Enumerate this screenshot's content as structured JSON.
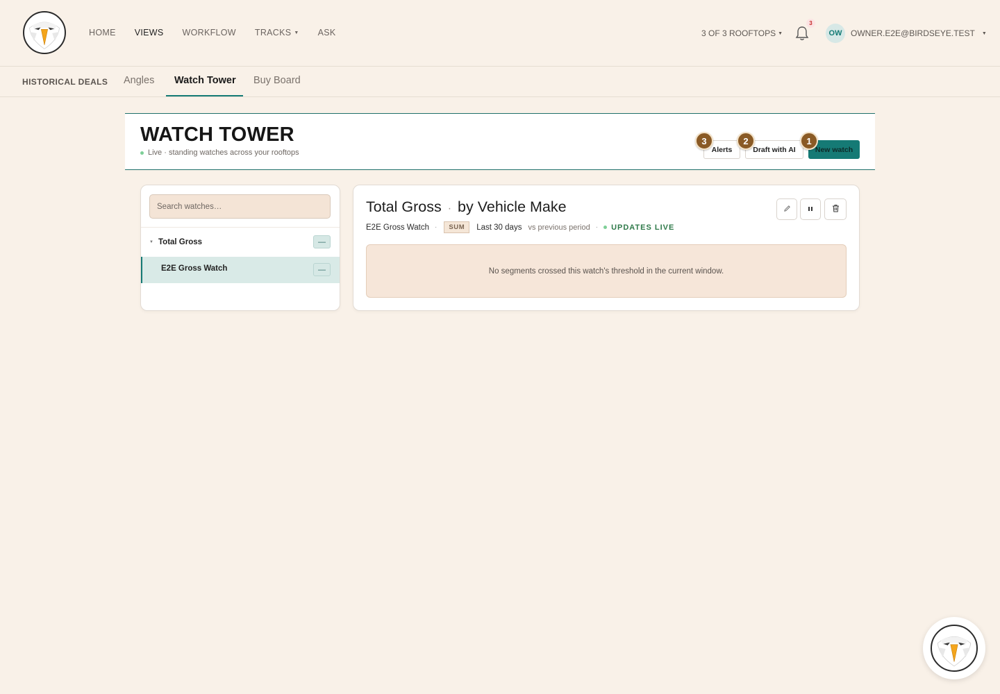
{
  "nav": {
    "items": [
      {
        "label": "HOME"
      },
      {
        "label": "VIEWS"
      },
      {
        "label": "WORKFLOW"
      },
      {
        "label": "TRACKS"
      },
      {
        "label": "ASK"
      }
    ],
    "rooftops": "3 OF 3 ROOFTOPS",
    "notification_count": "3",
    "avatar_initials": "OW",
    "user_email": "OWNER.E2E@BIRDSEYE.TEST"
  },
  "subnav": {
    "section": "HISTORICAL DEALS",
    "tabs": [
      {
        "label": "Angles"
      },
      {
        "label": "Watch Tower"
      },
      {
        "label": "Buy Board"
      }
    ]
  },
  "header": {
    "title": "WATCH TOWER",
    "subtitle": "Live · standing watches across your rooftops",
    "buttons": {
      "alerts": "Alerts",
      "draft": "Draft with AI",
      "new_watch": "New watch"
    },
    "steps": {
      "alerts": "3",
      "draft": "2",
      "new_watch": "1"
    }
  },
  "sidebar": {
    "search_placeholder": "Search watches…",
    "group_label": "Total Gross",
    "group_action": "—",
    "item_label": "E2E Gross Watch",
    "item_action": "—"
  },
  "watch": {
    "title_main": "Total Gross",
    "title_sep": "·",
    "title_dim": "by Vehicle Make",
    "name": "E2E Gross Watch",
    "aggregation": "SUM",
    "window": "Last 30 days",
    "comparison": "vs previous period",
    "status": "UPDATES LIVE",
    "empty_message": "No segments crossed this watch's threshold in the current window."
  },
  "colors": {
    "accent": "#157a75",
    "background": "#f9f1e8",
    "step_badge": "#8a5a25"
  }
}
